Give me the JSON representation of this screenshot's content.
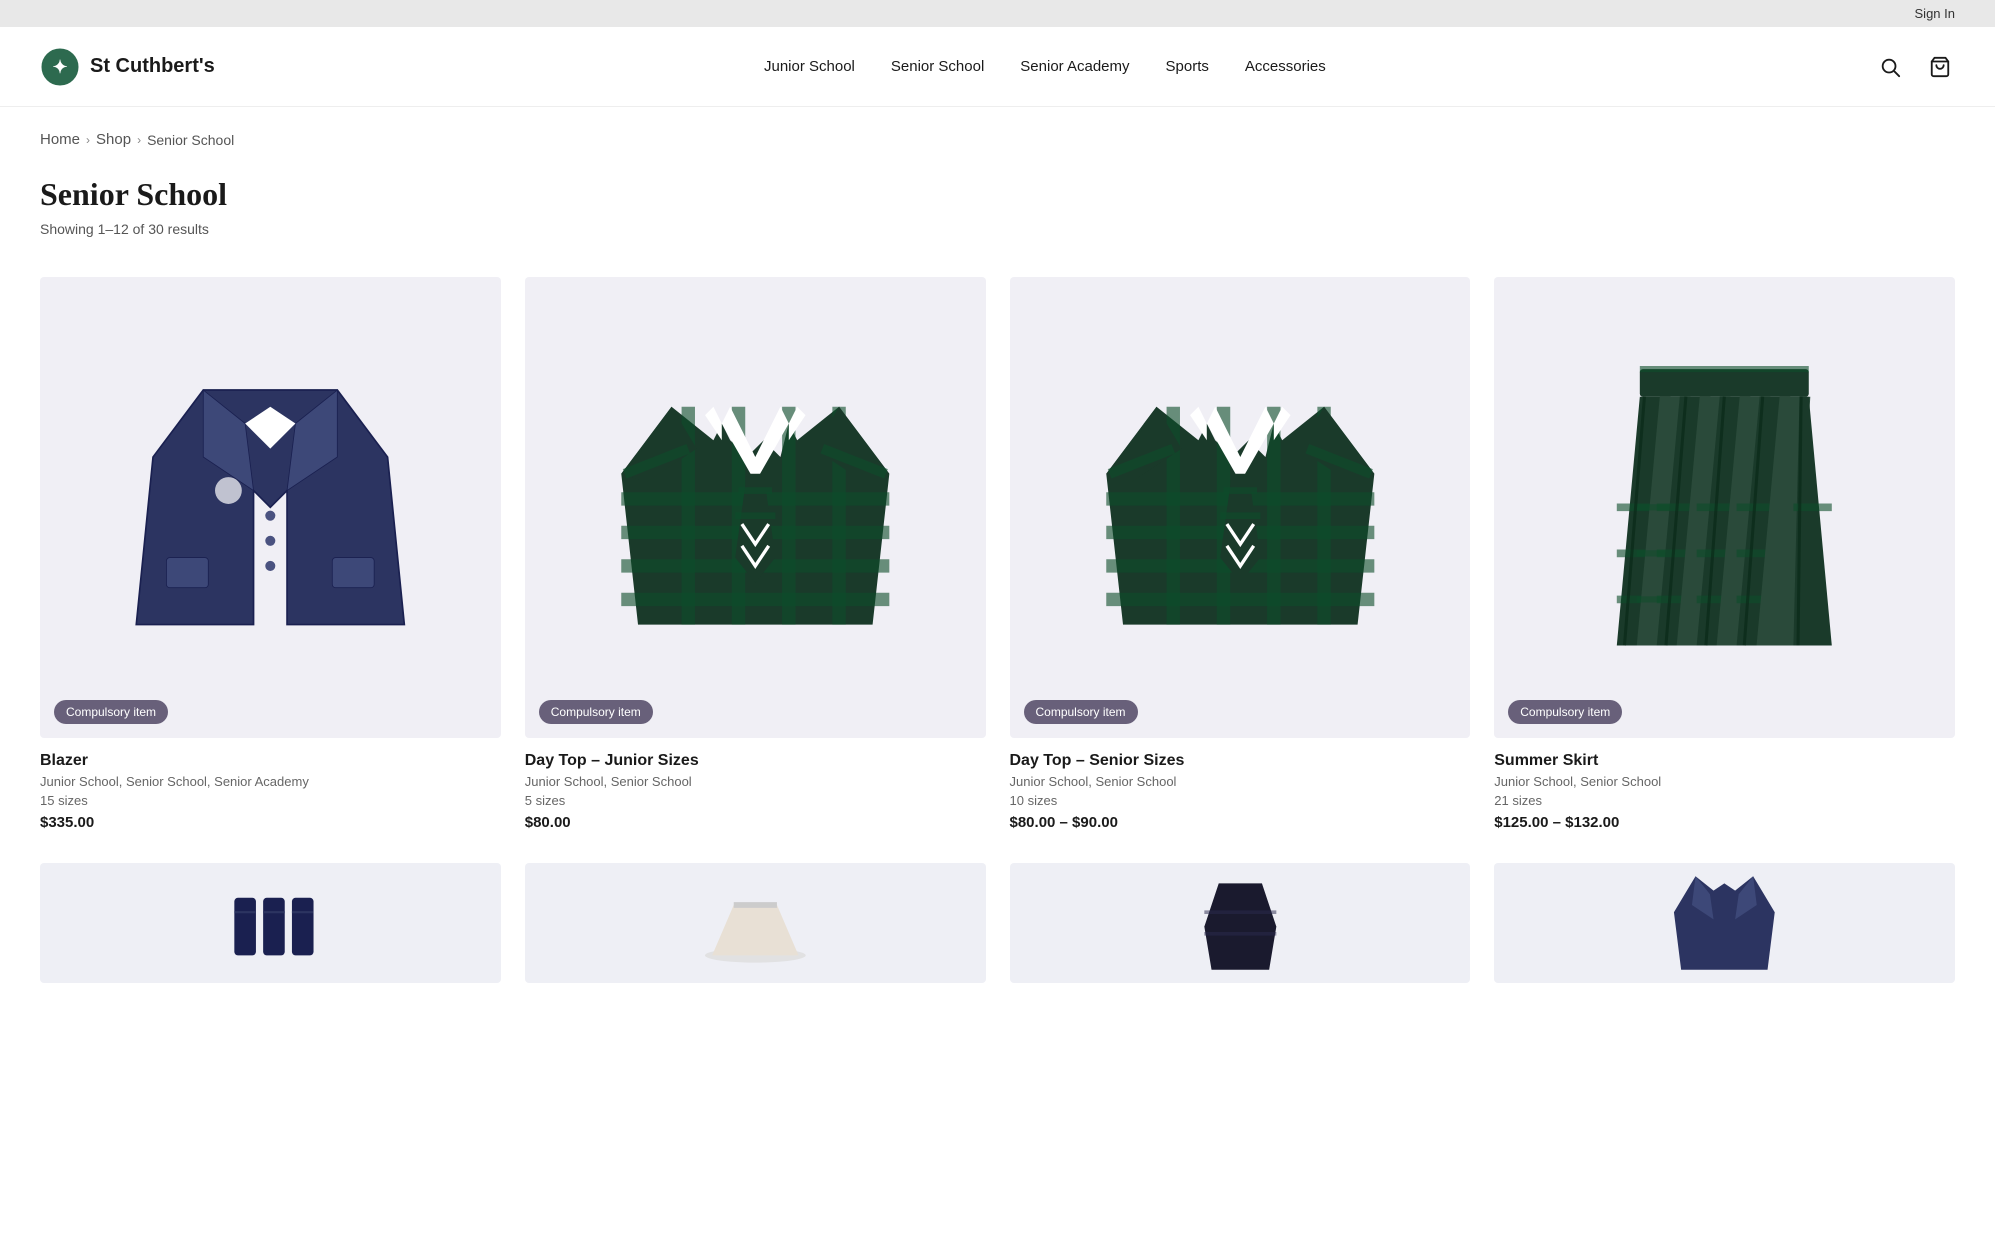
{
  "topbar": {
    "signin_label": "Sign In"
  },
  "header": {
    "logo_text": "St Cuthbert's",
    "nav_items": [
      {
        "id": "junior-school",
        "label": "Junior School"
      },
      {
        "id": "senior-school",
        "label": "Senior School"
      },
      {
        "id": "senior-academy",
        "label": "Senior Academy"
      },
      {
        "id": "sports",
        "label": "Sports"
      },
      {
        "id": "accessories",
        "label": "Accessories"
      }
    ]
  },
  "breadcrumb": {
    "home": "Home",
    "shop": "Shop",
    "current": "Senior School"
  },
  "page": {
    "title": "Senior School",
    "results_text": "Showing 1–12 of 30 results"
  },
  "badge_label": "Compulsory item",
  "products": [
    {
      "id": "blazer",
      "name": "Blazer",
      "categories": "Junior School, Senior School, Senior Academy",
      "sizes": "15 sizes",
      "price": "$335.00",
      "color": "#c8cad8"
    },
    {
      "id": "day-top-junior",
      "name": "Day Top – Junior Sizes",
      "categories": "Junior School, Senior School",
      "sizes": "5 sizes",
      "price": "$80.00",
      "color": "#c8cad8"
    },
    {
      "id": "day-top-senior",
      "name": "Day Top – Senior Sizes",
      "categories": "Junior School, Senior School",
      "sizes": "10 sizes",
      "price": "$80.00 – $90.00",
      "color": "#c8cad8"
    },
    {
      "id": "summer-skirt",
      "name": "Summer Skirt",
      "categories": "Junior School, Senior School",
      "sizes": "21 sizes",
      "price": "$125.00 – $132.00",
      "color": "#c8cad8"
    }
  ],
  "bottom_products": [
    {
      "id": "bottom-1",
      "color": "#c8cad8"
    },
    {
      "id": "bottom-2",
      "color": "#c8cad8"
    },
    {
      "id": "bottom-3",
      "color": "#c8cad8"
    },
    {
      "id": "bottom-4",
      "color": "#c8cad8"
    }
  ]
}
